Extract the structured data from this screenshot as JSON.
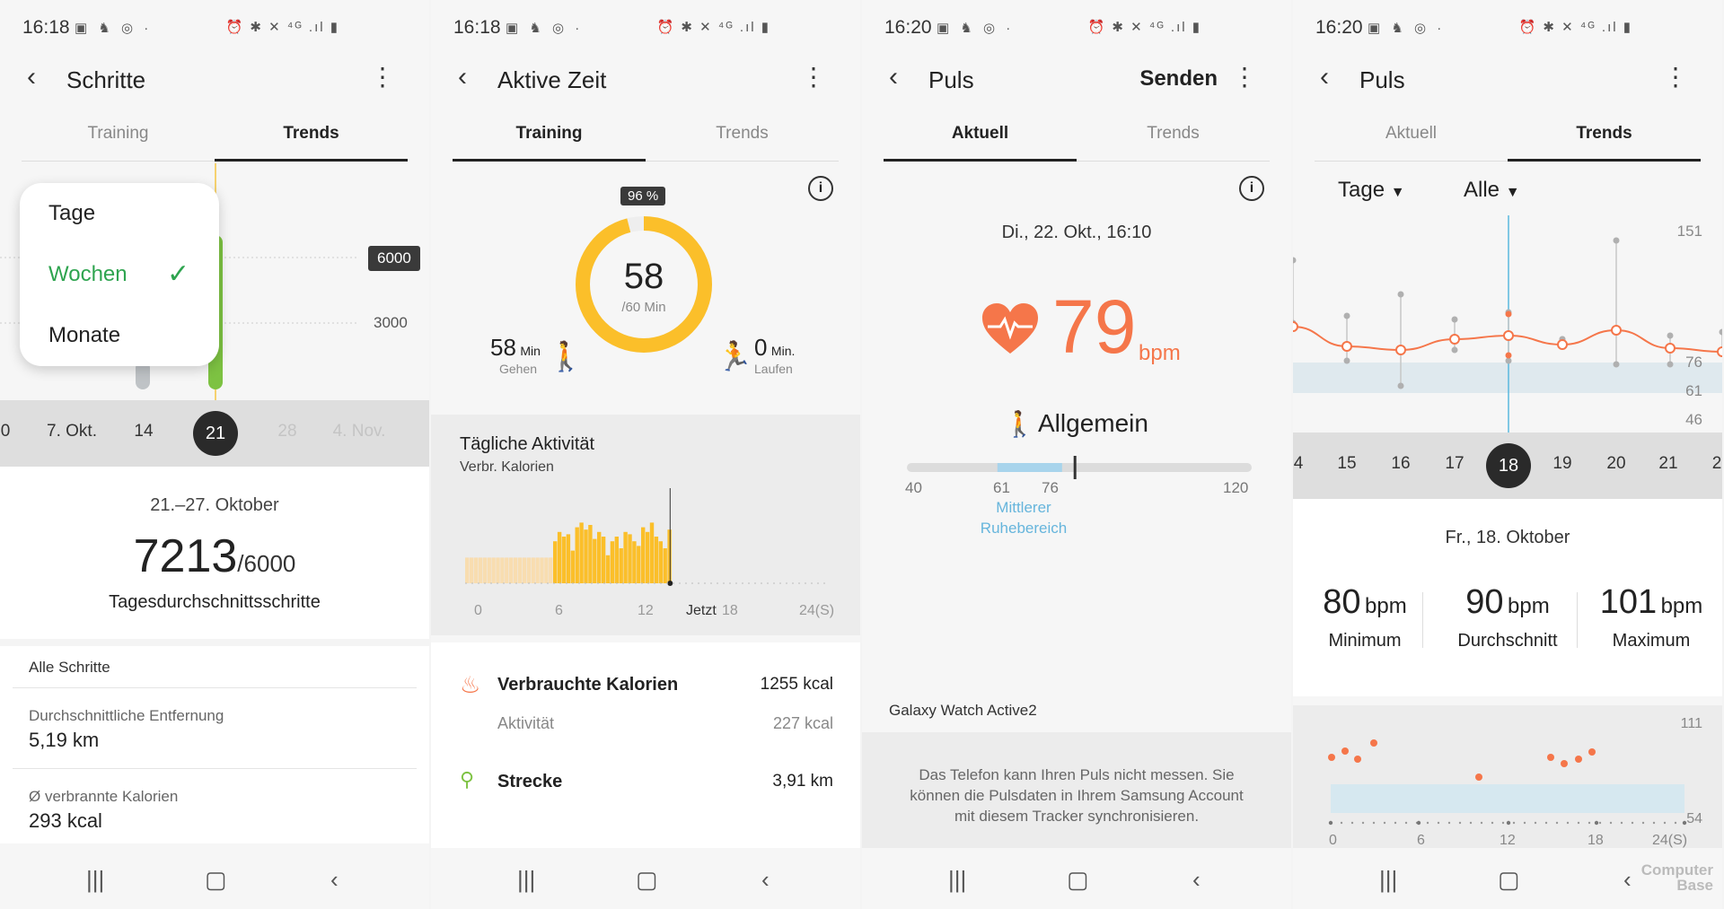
{
  "colors": {
    "accent_green": "#2ea44f",
    "orange": "#f5764a",
    "yellow": "#fbbf2a",
    "bar_dark": "#2a2a2a",
    "range_blue": "#a8d4ec"
  },
  "icons": {
    "back": "chevron-left-icon",
    "more": "more-vertical-icon",
    "nav_recent": "recent-apps-icon",
    "nav_home": "home-icon",
    "nav_back": "back-icon"
  },
  "status": {
    "p1": {
      "time": "16:18"
    },
    "p2": {
      "time": "16:18"
    },
    "p3": {
      "time": "16:20"
    },
    "p4": {
      "time": "16:20"
    },
    "left_icons": "▣ ♞ ◎ ·",
    "right_icons": "⏰ ✱ ✕ ⁴ᴳ .ıl ▮"
  },
  "p1": {
    "title": "Schritte",
    "tabs": [
      "Training",
      "Trends"
    ],
    "active_tab": 1,
    "menu": {
      "items": [
        "Tage",
        "Wochen",
        "Monate"
      ],
      "selected": 1,
      "check": "✓"
    },
    "goal_bubble": "6000",
    "axis_3000": "3000",
    "dates": [
      "0",
      "7. Okt.",
      "14",
      "21",
      "28",
      "4. Nov."
    ],
    "selected_date": "21",
    "range": "21.–27. Oktober",
    "value": "7213",
    "goal": "/6000",
    "caption": "Tagesdurchschnittsschritte",
    "list_header": "Alle Schritte",
    "rows": [
      {
        "label": "Durchschnittliche Entfernung",
        "value": "5,19 km"
      },
      {
        "label": "Ø verbrannte Kalorien",
        "value": "293 kcal"
      }
    ]
  },
  "p2": {
    "title": "Aktive Zeit",
    "tabs": [
      "Training",
      "Trends"
    ],
    "active_tab": 0,
    "percent": "96 %",
    "progress": 0.96,
    "ring_value": "58",
    "ring_goal": "/60 Min",
    "walk": {
      "value": "58",
      "unit": "Min",
      "label": "Gehen"
    },
    "run": {
      "value": "0",
      "unit": "Min.",
      "label": "Laufen"
    },
    "activity_title": "Tägliche Aktivität",
    "activity_subtitle": "Verbr. Kalorien",
    "axis": [
      "0",
      "6",
      "12",
      "Jetzt",
      "18",
      "24(S)"
    ],
    "calories": {
      "label": "Verbrauchte Kalorien",
      "value": "1255 kcal"
    },
    "activity": {
      "label": "Aktivität",
      "value": "227 kcal"
    },
    "distance": {
      "label": "Strecke",
      "value": "3,91 km"
    }
  },
  "p3": {
    "title": "Puls",
    "send": "Senden",
    "tabs": [
      "Aktuell",
      "Trends"
    ],
    "active_tab": 0,
    "datetime": "Di., 22. Okt., 16:10",
    "bpm": "79",
    "bpm_unit": "bpm",
    "category": "Allgemein",
    "scale": [
      "40",
      "61",
      "76",
      "120"
    ],
    "scale_min": 40,
    "scale_max": 120,
    "rest_low": 61,
    "rest_high": 76,
    "current": 79,
    "range_label_1": "Mittlerer",
    "range_label_2": "Ruhebereich",
    "device": "Galaxy Watch Active2",
    "note": "Das Telefon kann Ihren Puls nicht messen. Sie können die Pulsdaten in Ihrem Samsung Account mit diesem Tracker synchronisieren."
  },
  "p4": {
    "title": "Puls",
    "tabs": [
      "Aktuell",
      "Trends"
    ],
    "active_tab": 1,
    "filter_period": "Tage",
    "filter_type": "Alle",
    "y_labels": [
      "151",
      "76",
      "61",
      "46"
    ],
    "dates": [
      "4",
      "15",
      "16",
      "17",
      "18",
      "19",
      "20",
      "21",
      "2"
    ],
    "selected_date": "18",
    "date_title": "Fr., 18. Oktober",
    "stats": [
      {
        "value": "80",
        "unit": "bpm",
        "label": "Minimum"
      },
      {
        "value": "90",
        "unit": "bpm",
        "label": "Durchschnitt"
      },
      {
        "value": "101",
        "unit": "bpm",
        "label": "Maximum"
      }
    ],
    "day_y_top": "111",
    "day_y_bottom": "54",
    "day_axis": [
      "0",
      "6",
      "12",
      "18",
      "24(S)"
    ]
  },
  "watermark_1": "Computer",
  "watermark_2": "Base"
}
